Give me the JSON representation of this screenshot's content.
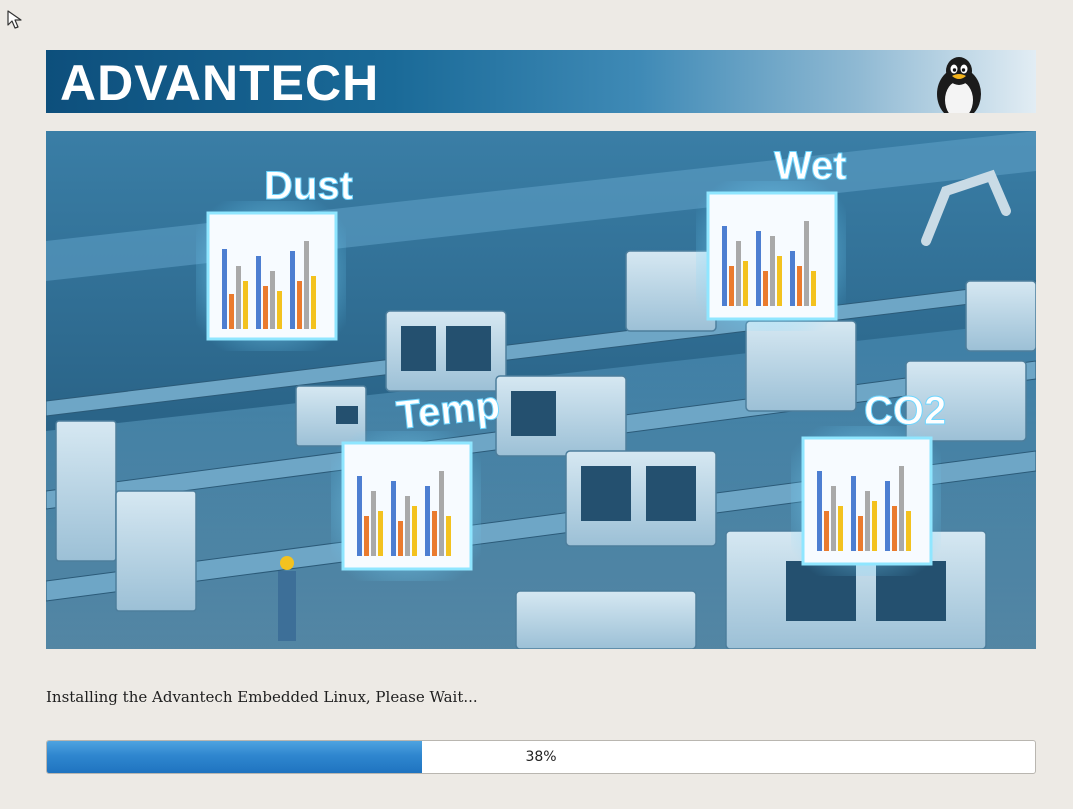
{
  "banner": {
    "brand": "ADVANTECH"
  },
  "hero": {
    "panels": [
      {
        "label": "Dust"
      },
      {
        "label": "Wet"
      },
      {
        "label": "Temp"
      },
      {
        "label": "CO2"
      }
    ]
  },
  "installer": {
    "status_text": "Installing the Advantech Embedded Linux, Please Wait...",
    "progress_percent": 38,
    "progress_label": "38%"
  },
  "icons": {
    "cursor": "mouse-pointer-icon",
    "tux": "tux-penguin-icon"
  },
  "colors": {
    "banner_dark": "#0d4f7c",
    "progress_fill": "#2f86cf",
    "background": "#edeae5"
  }
}
